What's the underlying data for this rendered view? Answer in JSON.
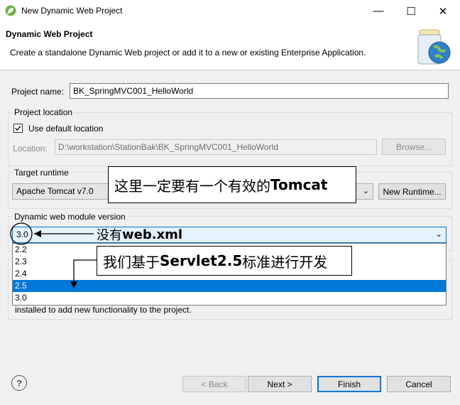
{
  "window": {
    "title": "New Dynamic Web Project",
    "minimize": "—",
    "maximize": "☐",
    "close": "✕"
  },
  "header": {
    "title": "Dynamic Web Project",
    "description": "Create a standalone Dynamic Web project or add it to a new or existing Enterprise Application."
  },
  "project_name": {
    "label": "Project name:",
    "value": "BK_SpringMVC001_HelloWorld"
  },
  "project_location": {
    "group_label": "Project location",
    "use_default_label": "Use default location",
    "use_default_checked": true,
    "location_label": "Location:",
    "location_value": "D:\\workstation\\StationBak\\BK_SpringMVC001_HelloWorld",
    "browse_label": "Browse..."
  },
  "target_runtime": {
    "group_label": "Target runtime",
    "selected": "Apache Tomcat v7.0",
    "new_runtime_label": "New Runtime..."
  },
  "module_version": {
    "group_label": "Dynamic web module version",
    "selected": "3.0",
    "options": [
      "2.2",
      "2.3",
      "2.4",
      "2.5",
      "3.0"
    ],
    "highlighted_index": 3
  },
  "hidden_text": "installed to add new functionality to the project.",
  "annotations": {
    "tomcat_prefix": "这里一定要有一个有效的",
    "tomcat_bold": "Tomcat",
    "webxml_prefix": "没有",
    "webxml_bold": "web.xml",
    "servlet_prefix": "我们基于",
    "servlet_bold": "Servlet2.5",
    "servlet_suffix": "标准进行开发"
  },
  "footer": {
    "help_icon": "?",
    "back_label": "< Back",
    "next_label": "Next >",
    "finish_label": "Finish",
    "cancel_label": "Cancel"
  },
  "colors": {
    "selection": "#0078d7",
    "annotation_border": "#000000"
  }
}
